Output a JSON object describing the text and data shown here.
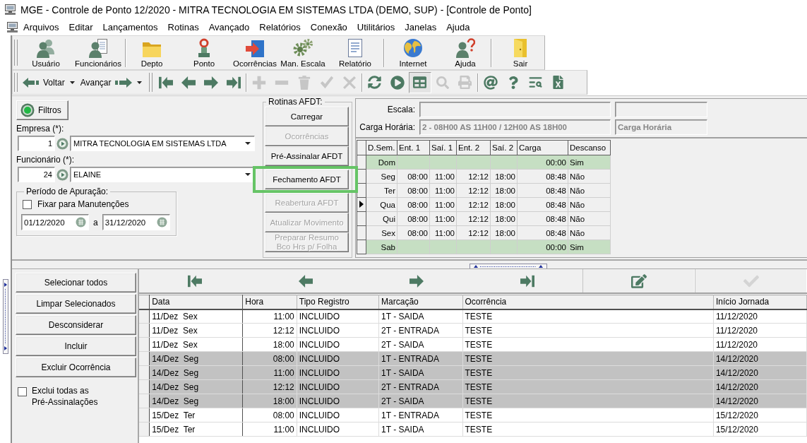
{
  "window": {
    "title": "MGE - Controle de Ponto 12/2020 - MITRA TECNOLOGIA EM SISTEMAS LTDA (DEMO, SUP) - [Controle de Ponto]"
  },
  "menu": [
    "Arquivos",
    "Editar",
    "Lançamentos",
    "Rotinas",
    "Avançado",
    "Relatórios",
    "Conexão",
    "Utilitários",
    "Janelas",
    "Ajuda"
  ],
  "main_toolbar": [
    {
      "buttons": [
        {
          "label": "Usuário"
        },
        {
          "label": "Funcionários"
        }
      ]
    },
    {
      "buttons": [
        {
          "label": "Depto"
        },
        {
          "label": "Ponto"
        },
        {
          "label": "Ocorrências"
        },
        {
          "label": "Man. Escala"
        },
        {
          "label": "Relatório"
        }
      ]
    },
    {
      "buttons": [
        {
          "label": "Internet"
        },
        {
          "label": "Ajuda"
        }
      ]
    },
    {
      "buttons": [
        {
          "label": "Sair"
        }
      ]
    }
  ],
  "nav_toolbar": {
    "back": "Voltar",
    "forward": "Avançar",
    "tool_groups": [
      [
        {
          "disabled": false,
          "pressed": false
        },
        {
          "disabled": false,
          "pressed": false
        },
        {
          "disabled": false,
          "pressed": false
        },
        {
          "disabled": false,
          "pressed": false
        }
      ],
      [
        {
          "disabled": true,
          "pressed": false
        },
        {
          "disabled": true,
          "pressed": false
        },
        {
          "disabled": true,
          "pressed": false
        },
        {
          "disabled": true,
          "pressed": false
        },
        {
          "disabled": true,
          "pressed": false
        }
      ],
      [
        {
          "disabled": false,
          "pressed": false
        },
        {
          "disabled": false,
          "pressed": false
        },
        {
          "disabled": false,
          "pressed": true
        },
        {
          "disabled": true,
          "pressed": false
        },
        {
          "disabled": true,
          "pressed": false
        }
      ],
      [
        {
          "disabled": false,
          "pressed": false
        },
        {
          "disabled": false,
          "pressed": false
        },
        {
          "disabled": false,
          "pressed": false
        },
        {
          "disabled": false,
          "pressed": false
        }
      ]
    ]
  },
  "filters": {
    "button": "Filtros",
    "empresa": {
      "label": "Empresa (*):",
      "code": "1",
      "value": "MITRA TECNOLOGIA EM SISTEMAS LTDA"
    },
    "funcionario": {
      "label": "Funcionário (*):",
      "code": "24",
      "value": "ELAINE"
    },
    "period": {
      "title": "Período de Apuração:",
      "fix": {
        "label": "Fixar para Manutenções",
        "checked": false
      },
      "start": "01/12/2020",
      "separator": "a",
      "end": "31/12/2020"
    }
  },
  "afdt": {
    "title": "Rotinas AFDT:",
    "buttons": [
      {
        "label": "Carregar",
        "disabled": false,
        "highlighted": false
      },
      {
        "label": "Ocorrências",
        "disabled": true,
        "highlighted": false
      },
      {
        "label": "Pré-Assinalar AFDT",
        "disabled": false,
        "highlighted": false
      },
      {
        "label": "Fechamento AFDT",
        "disabled": false,
        "highlighted": true
      },
      {
        "label": "Reabertura AFDT",
        "disabled": true,
        "highlighted": false
      },
      {
        "label": "Atualizar Movimento",
        "disabled": true,
        "highlighted": false
      },
      {
        "label": "Preparar Resumo Bco Hrs p/ Folha",
        "disabled": true,
        "highlighted": false
      }
    ]
  },
  "schedule": {
    "escala_label": "Escala:",
    "carga_label": "Carga Horária:",
    "carga_value": "2 - 08H00 AS 11H00 / 12H00 AS 18H00",
    "carga_description": "Carga Horária",
    "columns": [
      "D.Sem.",
      "Ent. 1",
      "Saí. 1",
      "Ent. 2",
      "Saí. 2",
      "Carga",
      "Descanso"
    ],
    "rows": [
      {
        "day": "Dom",
        "carga": "00:00",
        "descanso": "Sim",
        "rest": true,
        "current": false
      },
      {
        "day": "Seg",
        "ent_1": "08:00",
        "sai_1": "11:00",
        "ent_2": "12:12",
        "sai_2": "18:00",
        "carga": "08:48",
        "descanso": "Não",
        "rest": false,
        "current": false
      },
      {
        "day": "Ter",
        "ent_1": "08:00",
        "sai_1": "11:00",
        "ent_2": "12:12",
        "sai_2": "18:00",
        "carga": "08:48",
        "descanso": "Não",
        "rest": false,
        "current": false
      },
      {
        "day": "Qua",
        "ent_1": "08:00",
        "sai_1": "11:00",
        "ent_2": "12:12",
        "sai_2": "18:00",
        "carga": "08:48",
        "descanso": "Não",
        "rest": false,
        "current": true
      },
      {
        "day": "Qui",
        "ent_1": "08:00",
        "sai_1": "11:00",
        "ent_2": "12:12",
        "sai_2": "18:00",
        "carga": "08:48",
        "descanso": "Não",
        "rest": false,
        "current": false
      },
      {
        "day": "Sex",
        "ent_1": "08:00",
        "sai_1": "11:00",
        "ent_2": "12:12",
        "sai_2": "18:00",
        "carga": "08:48",
        "descanso": "Não",
        "rest": false,
        "current": false
      },
      {
        "day": "Sab",
        "carga": "00:00",
        "descanso": "Sim",
        "rest": true,
        "current": false
      }
    ]
  },
  "actions": [
    "Selecionar todos",
    "Limpar Selecionados",
    "Desconsiderar",
    "Incluir",
    "Excluir Ocorrência"
  ],
  "exclude_all": {
    "label": "Exclui todas as Pré-Assinalações",
    "checked": false
  },
  "record_toolbar": {
    "nav": [
      {
        "disabled": false
      },
      {
        "disabled": false
      },
      {
        "disabled": false
      },
      {
        "disabled": false
      }
    ],
    "actions": [
      {
        "disabled": false
      },
      {
        "disabled": true
      }
    ]
  },
  "records": {
    "columns": [
      "Data",
      "Hora",
      "Tipo Registro",
      "Marcação",
      "Ocorrência",
      "Início Jornada"
    ],
    "rows": [
      {
        "cells": [
          "11/Dez  Sex",
          "11:00",
          "INCLUIDO",
          "1T - SAIDA",
          "TESTE",
          "11/12/2020"
        ],
        "selected": false
      },
      {
        "cells": [
          "11/Dez  Sex",
          "12:12",
          "INCLUIDO",
          "2T - ENTRADA",
          "TESTE",
          "11/12/2020"
        ],
        "selected": false
      },
      {
        "cells": [
          "11/Dez  Sex",
          "18:00",
          "INCLUIDO",
          "2T - SAIDA",
          "TESTE",
          "11/12/2020"
        ],
        "selected": false
      },
      {
        "cells": [
          "14/Dez  Seg",
          "08:00",
          "INCLUIDO",
          "1T - ENTRADA",
          "TESTE",
          "14/12/2020"
        ],
        "selected": true
      },
      {
        "cells": [
          "14/Dez  Seg",
          "11:00",
          "INCLUIDO",
          "1T - SAIDA",
          "TESTE",
          "14/12/2020"
        ],
        "selected": true
      },
      {
        "cells": [
          "14/Dez  Seg",
          "12:12",
          "INCLUIDO",
          "2T - ENTRADA",
          "TESTE",
          "14/12/2020"
        ],
        "selected": true
      },
      {
        "cells": [
          "14/Dez  Seg",
          "18:00",
          "INCLUIDO",
          "2T - SAIDA",
          "TESTE",
          "14/12/2020"
        ],
        "selected": true
      },
      {
        "cells": [
          "15/Dez  Ter",
          "08:00",
          "INCLUIDO",
          "1T - ENTRADA",
          "TESTE",
          "15/12/2020"
        ],
        "selected": false
      },
      {
        "cells": [
          "15/Dez  Ter",
          "11:00",
          "INCLUIDO",
          "1T - SAIDA",
          "TESTE",
          "15/12/2020"
        ],
        "selected": false
      }
    ]
  }
}
